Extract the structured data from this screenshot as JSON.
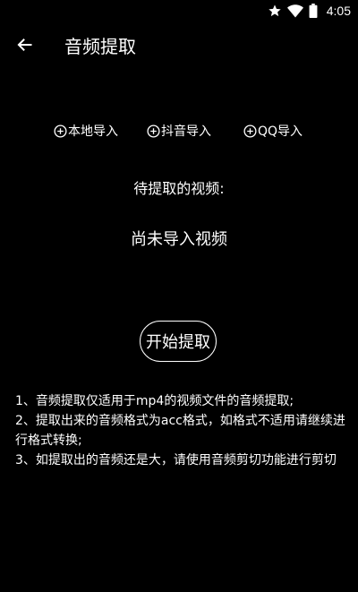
{
  "status_bar": {
    "time": "4:05",
    "icons": [
      "star-icon",
      "wifi-icon",
      "battery-icon"
    ]
  },
  "app_bar": {
    "title": "音频提取",
    "back_icon": "arrow-back-icon"
  },
  "import_buttons": {
    "local": "本地导入",
    "douyin": "抖音导入",
    "qq": "QQ导入",
    "icon": "plus-circle-icon"
  },
  "main": {
    "pending_label": "待提取的视频:",
    "no_video_text": "尚未导入视频",
    "start_button": "开始提取"
  },
  "notes": [
    "1、音频提取仅适用于mp4的视频文件的音频提取;",
    "2、提取出来的音频格式为acc格式，如格式不适用请继续进行格式转换;",
    "3、如提取出的音频还是大，请使用音频剪切功能进行剪切"
  ],
  "colors": {
    "background": "#000000",
    "text": "#ffffff"
  }
}
